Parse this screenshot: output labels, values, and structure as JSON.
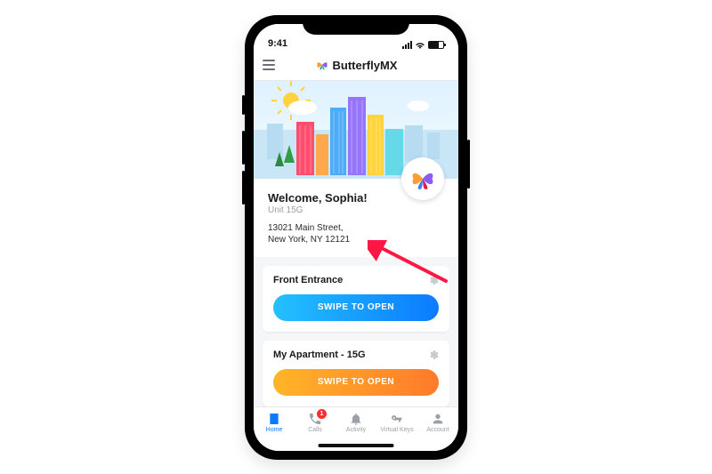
{
  "status": {
    "time": "9:41"
  },
  "brand": {
    "name": "ButterflyMX"
  },
  "welcome": {
    "greeting": "Welcome, Sophia!",
    "unit": "Unit 15G",
    "address_line1": "13021 Main Street,",
    "address_line2": "New York, NY 12121"
  },
  "doors": [
    {
      "title": "Front Entrance",
      "swipe_label": "SWIPE TO OPEN",
      "swipe_color": "blue"
    },
    {
      "title": "My Apartment - 15G",
      "swipe_label": "SWIPE TO OPEN",
      "swipe_color": "orange"
    }
  ],
  "tabs": {
    "home": "Home",
    "calls": "Calls",
    "calls_badge": "1",
    "activity": "Activity",
    "virtual_keys": "Virtual Keys",
    "account": "Account"
  },
  "colors": {
    "blue": "#0b7bff",
    "cyan": "#24c1ff",
    "orange1": "#ffb527",
    "orange2": "#ff7a2a"
  }
}
